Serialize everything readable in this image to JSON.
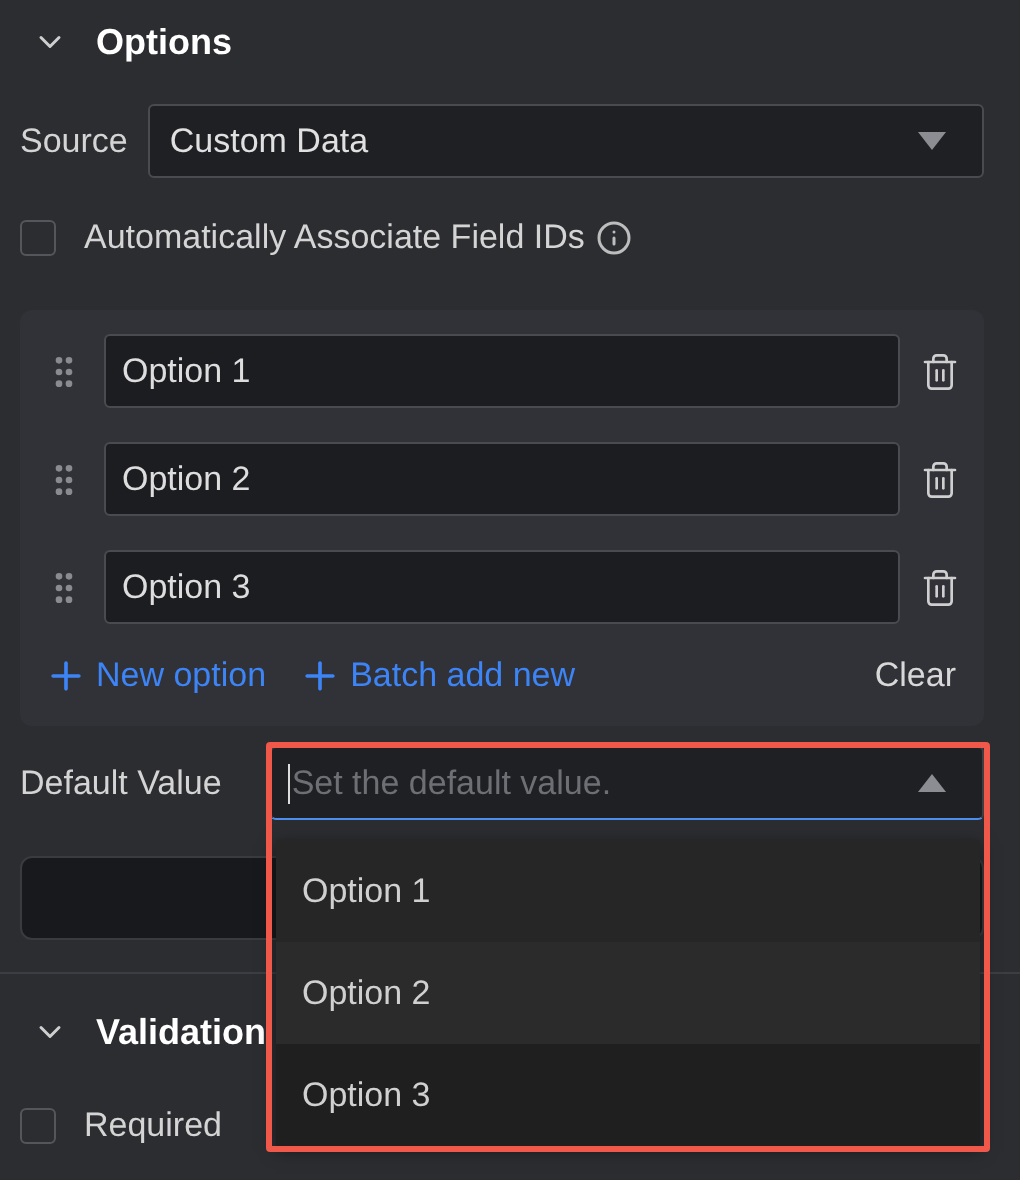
{
  "options_section": {
    "title": "Options",
    "expanded": true
  },
  "source": {
    "label": "Source",
    "value": "Custom Data"
  },
  "auto_associate": {
    "label": "Automatically Associate Field IDs",
    "checked": false
  },
  "option_list": [
    {
      "value": "Option 1"
    },
    {
      "value": "Option 2"
    },
    {
      "value": "Option 3"
    }
  ],
  "actions": {
    "new_option": "New option",
    "batch_add": "Batch add new",
    "clear": "Clear"
  },
  "default_value": {
    "label": "Default Value",
    "placeholder": "Set the default value.",
    "open": true,
    "menu": [
      "Option 1",
      "Option 2",
      "Option 3"
    ]
  },
  "validation_section": {
    "title": "Validation",
    "expanded": true
  },
  "required": {
    "label": "Required",
    "checked": false
  }
}
